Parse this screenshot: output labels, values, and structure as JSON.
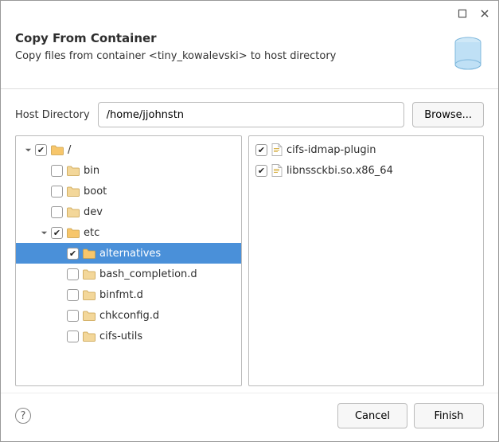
{
  "titlebar": {
    "max_icon": "❐",
    "close_icon": "✕"
  },
  "header": {
    "title": "Copy From Container",
    "subtitle": "Copy files from container <tiny_kowalevski> to host directory"
  },
  "form": {
    "host_dir_label": "Host Directory",
    "host_dir_value": "/home/jjohnstn",
    "browse_label": "Browse..."
  },
  "tree": [
    {
      "depth": 0,
      "expander": "down",
      "checked": true,
      "open": true,
      "label": "/"
    },
    {
      "depth": 1,
      "expander": "none",
      "checked": false,
      "open": false,
      "label": "bin"
    },
    {
      "depth": 1,
      "expander": "none",
      "checked": false,
      "open": false,
      "label": "boot"
    },
    {
      "depth": 1,
      "expander": "none",
      "checked": false,
      "open": false,
      "label": "dev"
    },
    {
      "depth": 1,
      "expander": "down",
      "checked": true,
      "open": true,
      "label": "etc"
    },
    {
      "depth": 2,
      "expander": "none",
      "checked": true,
      "open": true,
      "label": "alternatives",
      "selected": true
    },
    {
      "depth": 2,
      "expander": "none",
      "checked": false,
      "open": false,
      "label": "bash_completion.d"
    },
    {
      "depth": 2,
      "expander": "none",
      "checked": false,
      "open": false,
      "label": "binfmt.d"
    },
    {
      "depth": 2,
      "expander": "none",
      "checked": false,
      "open": false,
      "label": "chkconfig.d"
    },
    {
      "depth": 2,
      "expander": "none",
      "checked": false,
      "open": false,
      "label": "cifs-utils"
    }
  ],
  "files": [
    {
      "checked": true,
      "label": "cifs-idmap-plugin"
    },
    {
      "checked": true,
      "label": "libnssckbi.so.x86_64"
    }
  ],
  "footer": {
    "cancel_label": "Cancel",
    "finish_label": "Finish"
  }
}
